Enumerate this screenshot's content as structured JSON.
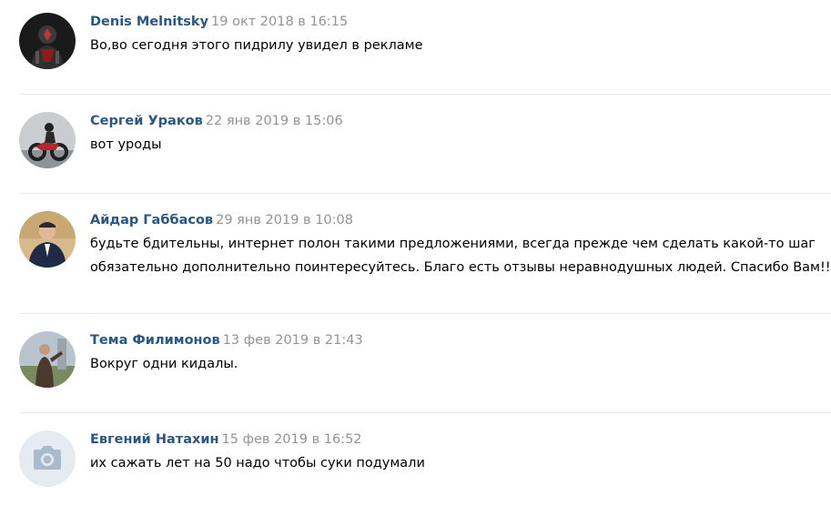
{
  "comments": [
    {
      "author": "Denis Melnitsky",
      "date": "19 окт 2018 в 16:15",
      "text": [
        "Во,во сегодня этого пидрилу увидел в рекламе"
      ],
      "avatar_icon": "armored-figure-photo"
    },
    {
      "author": "Сергей Ураков",
      "date": "22 янв 2019 в 15:06",
      "text": [
        "вот уроды"
      ],
      "avatar_icon": "motorcycle-rider-photo"
    },
    {
      "author": "Айдар Габбасов",
      "date": "29 янв 2019 в 10:08",
      "text": [
        "будьте бдительны, интернет полон такими предложениями, всегда прежде чем сделать какой-то шаг",
        "обязательно дополнительно поинтересуйтесь. Благо есть отзывы неравнодушных людей. Спасибо Вам!!"
      ],
      "avatar_icon": "man-in-suit-photo"
    },
    {
      "author": "Тема Филимонов",
      "date": "13 фев 2019 в 21:43",
      "text": [
        "Вокруг одни кидалы."
      ],
      "avatar_icon": "man-outdoors-photo"
    },
    {
      "author": "Евгений Натахин",
      "date": "15 фев 2019 в 16:52",
      "text": [
        "их сажать лет на 50 надо чтобы суки подумали"
      ],
      "avatar_icon": "camera-placeholder-icon"
    }
  ],
  "colors": {
    "author": "#2a5885",
    "date": "#939393",
    "text": "#000000",
    "divider": "#e7e8ec",
    "placeholder_bg": "#e5ebf1",
    "placeholder_icon": "#a9bccf"
  }
}
